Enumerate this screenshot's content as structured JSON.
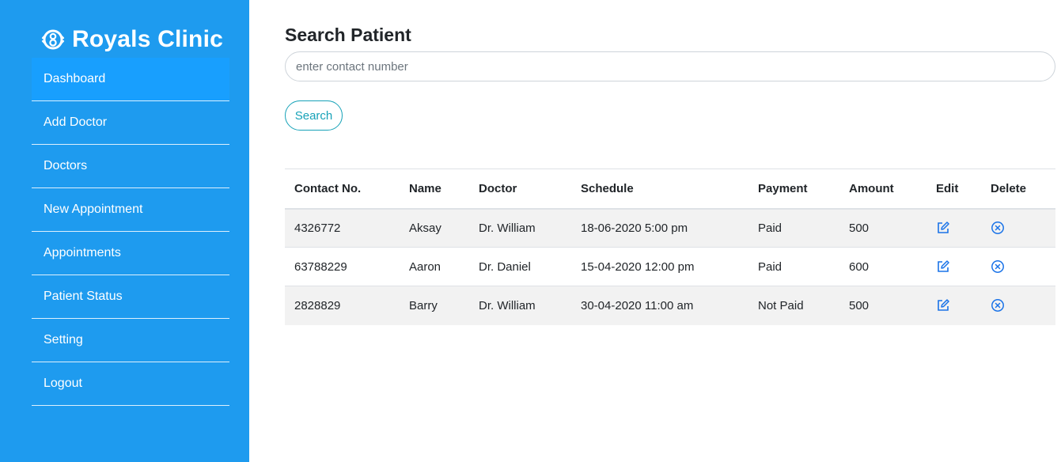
{
  "brand": {
    "title": "Royals Clinic",
    "icon": "clinic-logo-icon"
  },
  "sidebar": {
    "items": [
      {
        "label": "Dashboard"
      },
      {
        "label": "Add Doctor"
      },
      {
        "label": "Doctors"
      },
      {
        "label": "New Appointment"
      },
      {
        "label": "Appointments"
      },
      {
        "label": "Patient Status"
      },
      {
        "label": "Setting"
      },
      {
        "label": "Logout"
      }
    ],
    "active": "Dashboard"
  },
  "main": {
    "title": "Search Patient",
    "search": {
      "placeholder": "enter contact number",
      "value": "",
      "button_label": "Search"
    },
    "table": {
      "columns": [
        "Contact No.",
        "Name",
        "Doctor",
        "Schedule",
        "Payment",
        "Amount",
        "Edit",
        "Delete"
      ],
      "rows": [
        {
          "contact": "4326772",
          "name": "Aksay",
          "doctor": "Dr. William",
          "schedule": "18-06-2020 5:00 pm",
          "payment": "Paid",
          "amount": "500"
        },
        {
          "contact": "63788229",
          "name": "Aaron",
          "doctor": "Dr. Daniel",
          "schedule": "15-04-2020 12:00 pm",
          "payment": "Paid",
          "amount": "600"
        },
        {
          "contact": "2828829",
          "name": "Barry",
          "doctor": "Dr. William",
          "schedule": "30-04-2020 11:00 am",
          "payment": "Not Paid",
          "amount": "500"
        }
      ]
    }
  },
  "colors": {
    "sidebar_bg": "#1e9bef",
    "active_item": "#189ffe",
    "search_button": "#17a2b8",
    "action_icon": "#1a73e8"
  },
  "icons": {
    "edit": "edit-icon",
    "delete": "delete-icon"
  }
}
